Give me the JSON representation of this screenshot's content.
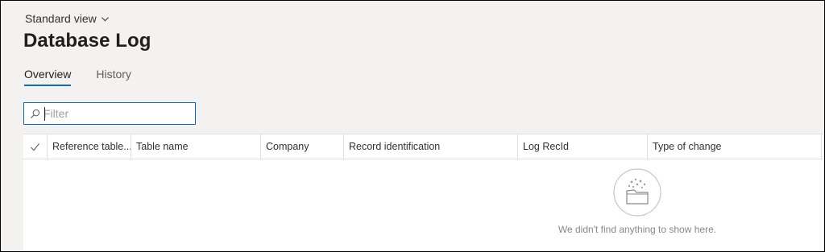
{
  "view": {
    "label": "Standard view"
  },
  "page": {
    "title": "Database Log"
  },
  "tabs": [
    {
      "label": "Overview",
      "active": true
    },
    {
      "label": "History",
      "active": false
    }
  ],
  "filter": {
    "placeholder": "Filter",
    "value": ""
  },
  "grid": {
    "columns": [
      "Reference table...",
      "Table name",
      "Company",
      "Record identification",
      "Log RecId",
      "Type of change"
    ],
    "rows": [],
    "empty_message": "We didn't find anything to show here."
  },
  "icons": {
    "view_menu": "chevron-down-icon",
    "filter": "search-icon",
    "select_all": "checkmark-icon",
    "empty": "empty-folder-icon"
  },
  "colors": {
    "accent": "#0f6cbd",
    "background": "#f3f2f1",
    "border": "#e1dfdd"
  }
}
